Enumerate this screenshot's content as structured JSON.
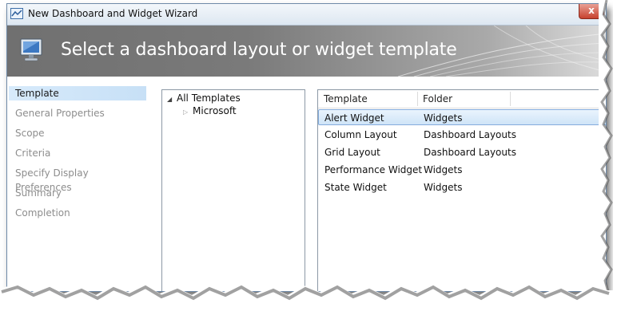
{
  "window": {
    "title": "New Dashboard and Widget Wizard",
    "close_label": "x"
  },
  "banner": {
    "title": "Select a dashboard layout or widget template"
  },
  "nav": {
    "items": [
      {
        "label": "Template",
        "active": true
      },
      {
        "label": "General Properties",
        "active": false
      },
      {
        "label": "Scope",
        "active": false
      },
      {
        "label": "Criteria",
        "active": false
      },
      {
        "label": "Specify Display Preferences",
        "active": false
      },
      {
        "label": "Summary",
        "active": false
      },
      {
        "label": "Completion",
        "active": false
      }
    ]
  },
  "tree": {
    "root": {
      "label": "All Templates",
      "expanded": true
    },
    "children": [
      {
        "label": "Microsoft",
        "expanded": false
      }
    ]
  },
  "list": {
    "columns": [
      "Template",
      "Folder"
    ],
    "rows": [
      {
        "template": "Alert Widget",
        "folder": "Widgets",
        "selected": true
      },
      {
        "template": "Column Layout",
        "folder": "Dashboard Layouts",
        "selected": false
      },
      {
        "template": "Grid Layout",
        "folder": "Dashboard Layouts",
        "selected": false
      },
      {
        "template": "Performance Widget",
        "folder": "Widgets",
        "selected": false
      },
      {
        "template": "State Widget",
        "folder": "Widgets",
        "selected": false
      }
    ]
  },
  "colors": {
    "accent_selection": "#cfe4f7",
    "banner_dark": "#707070",
    "close_red": "#c7422f"
  },
  "icons": {
    "window": "dashboard-window-icon",
    "banner": "monitor-icon",
    "tree_expanded": "triangle-down-icon",
    "tree_collapsed": "triangle-right-icon"
  }
}
